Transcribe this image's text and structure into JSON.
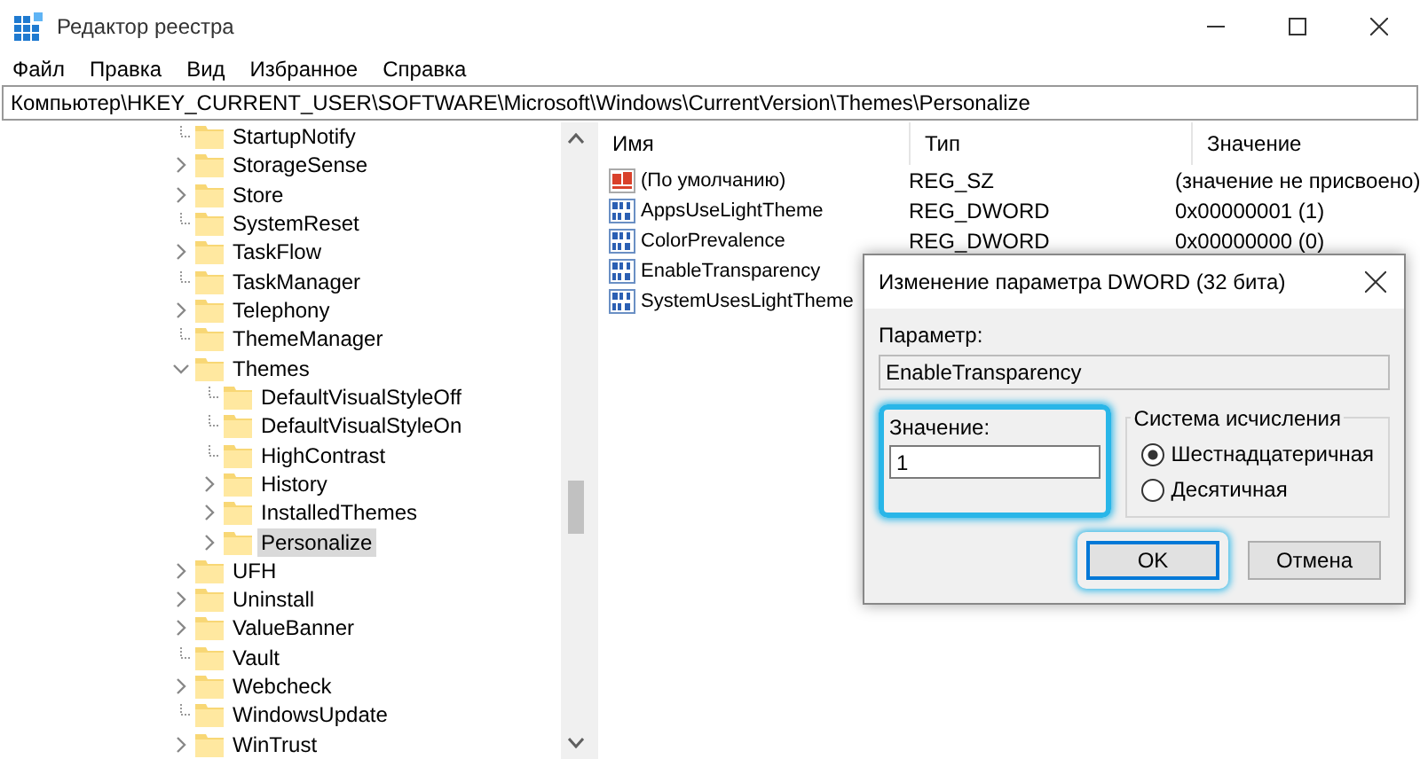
{
  "window": {
    "title": "Редактор реестра"
  },
  "menu": [
    "Файл",
    "Правка",
    "Вид",
    "Избранное",
    "Справка"
  ],
  "address": "Компьютер\\HKEY_CURRENT_USER\\SOFTWARE\\Microsoft\\Windows\\CurrentVersion\\Themes\\Personalize",
  "tree": [
    {
      "label": "StartupNotify",
      "expandable": false,
      "selected": false
    },
    {
      "label": "StorageSense",
      "expandable": true,
      "expanded": false,
      "selected": false
    },
    {
      "label": "Store",
      "expandable": true,
      "expanded": false,
      "selected": false
    },
    {
      "label": "SystemReset",
      "expandable": false,
      "selected": false
    },
    {
      "label": "TaskFlow",
      "expandable": true,
      "expanded": false,
      "selected": false
    },
    {
      "label": "TaskManager",
      "expandable": false,
      "selected": false
    },
    {
      "label": "Telephony",
      "expandable": true,
      "expanded": false,
      "selected": false
    },
    {
      "label": "ThemeManager",
      "expandable": false,
      "selected": false
    },
    {
      "label": "Themes",
      "expandable": true,
      "expanded": true,
      "selected": false,
      "children": [
        {
          "label": "DefaultVisualStyleOff",
          "expandable": false,
          "selected": false
        },
        {
          "label": "DefaultVisualStyleOn",
          "expandable": false,
          "selected": false
        },
        {
          "label": "HighContrast",
          "expandable": false,
          "selected": false
        },
        {
          "label": "History",
          "expandable": true,
          "expanded": false,
          "selected": false
        },
        {
          "label": "InstalledThemes",
          "expandable": true,
          "expanded": false,
          "selected": false
        },
        {
          "label": "Personalize",
          "expandable": true,
          "expanded": false,
          "selected": true
        }
      ]
    },
    {
      "label": "UFH",
      "expandable": true,
      "expanded": false,
      "selected": false
    },
    {
      "label": "Uninstall",
      "expandable": true,
      "expanded": false,
      "selected": false
    },
    {
      "label": "ValueBanner",
      "expandable": true,
      "expanded": false,
      "selected": false
    },
    {
      "label": "Vault",
      "expandable": false,
      "selected": false
    },
    {
      "label": "Webcheck",
      "expandable": true,
      "expanded": false,
      "selected": false
    },
    {
      "label": "WindowsUpdate",
      "expandable": false,
      "selected": false
    },
    {
      "label": "WinTrust",
      "expandable": true,
      "expanded": false,
      "selected": false
    }
  ],
  "values_table": {
    "columns": [
      "Имя",
      "Тип",
      "Значение"
    ],
    "rows": [
      {
        "kind": "string",
        "name": "(По умолчанию)",
        "type": "REG_SZ",
        "value": "(значение не присвоено)"
      },
      {
        "kind": "dword",
        "name": "AppsUseLightTheme",
        "type": "REG_DWORD",
        "value": "0x00000001 (1)"
      },
      {
        "kind": "dword",
        "name": "ColorPrevalence",
        "type": "REG_DWORD",
        "value": "0x00000000 (0)"
      },
      {
        "kind": "dword",
        "name": "EnableTransparency"
      },
      {
        "kind": "dword",
        "name": "SystemUsesLightTheme"
      }
    ]
  },
  "dialog": {
    "title": "Изменение параметра DWORD (32 бита)",
    "param_label": "Параметр:",
    "param_value": "EnableTransparency",
    "value_label": "Значение:",
    "value": "1",
    "value_highlighted": true,
    "base_group": {
      "title": "Система исчисления",
      "options": [
        {
          "label": "Шестнадцатеричная",
          "selected": true
        },
        {
          "label": "Десятичная",
          "selected": false
        }
      ]
    },
    "buttons": [
      {
        "label": "OK",
        "kind": "default",
        "highlighted": true
      },
      {
        "label": "Отмена",
        "kind": "normal",
        "highlighted": false
      }
    ]
  }
}
